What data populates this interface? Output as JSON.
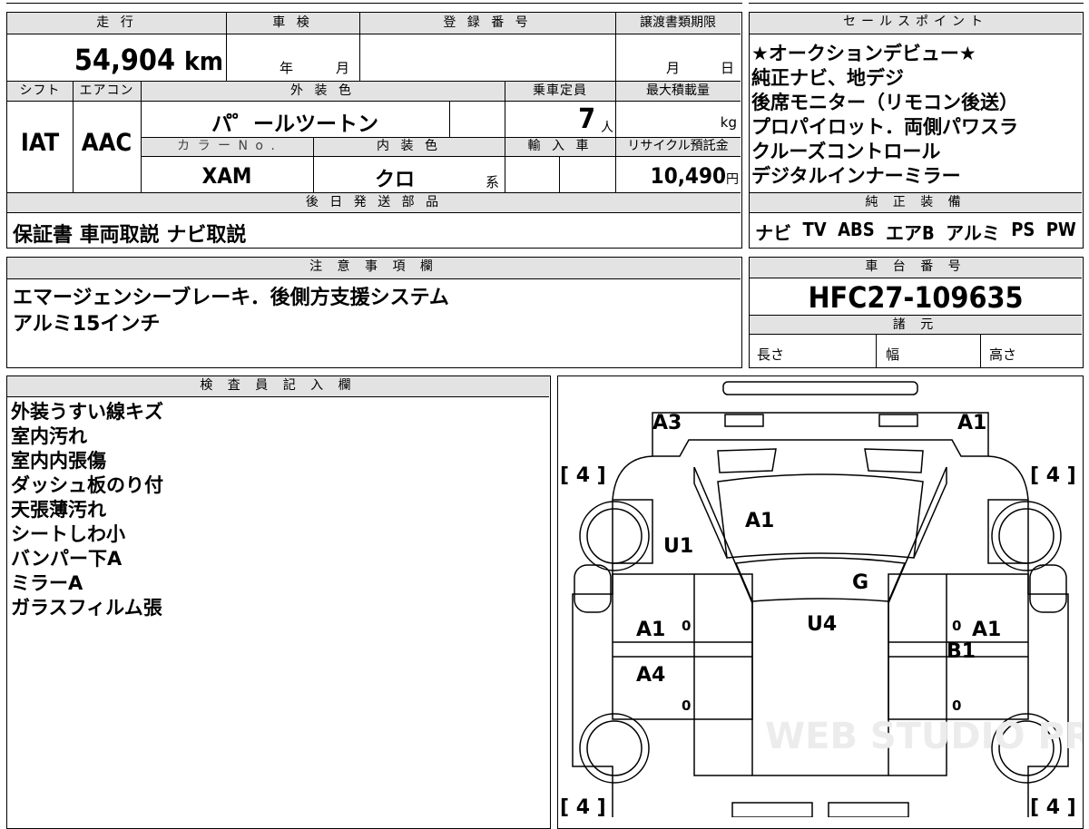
{
  "vehicle": {
    "mileage_label": "走 行",
    "mileage_value": "54,904",
    "mileage_unit": "km",
    "inspection_label": "車 検",
    "inspection_year": "年",
    "inspection_month": "月",
    "reg_label": "登 録 番 号",
    "transfer_label": "譲渡書類期限",
    "transfer_month": "月",
    "transfer_day": "日",
    "shift_label": "シフト",
    "shift_value": "IAT",
    "ac_label": "エアコン",
    "ac_value": "AAC",
    "exterior_label": "外 装 色",
    "exterior_value": "パ゜ールツートン",
    "capacity_label": "乗車定員",
    "capacity_value": "7",
    "capacity_unit": "人",
    "load_label": "最大積載量",
    "load_unit": "kg",
    "color_no_label": "カ ラ ー N o .",
    "color_no_value": "XAM",
    "interior_label": "内 装 色",
    "interior_value": "クロ",
    "interior_suffix": "系",
    "import_label": "輸 入 車",
    "recycle_label": "リサイクル預託金",
    "recycle_value": "10,490",
    "recycle_unit": "円",
    "later_label": "後 日 発 送 部 品",
    "later_value": "保証書 車両取説 ナビ取説"
  },
  "sales": {
    "label": "セールスポイント",
    "items": [
      "★オークションデビュー★",
      "純正ナビ、地デジ",
      "後席モニター（リモコン後送）",
      "プロパイロット．両側パワスラ",
      "クルーズコントロール",
      "デジタルインナーミラー"
    ]
  },
  "equipment": {
    "label": "純 正 装 備",
    "items": [
      "ナビ",
      "TV",
      "ABS",
      "エアB",
      "アルミ",
      "PS",
      "PW"
    ]
  },
  "notes": {
    "label": "注 意 事 項 欄",
    "lines": [
      "エマージェンシーブレーキ．後側方支援システム",
      "アルミ15インチ"
    ]
  },
  "chassis": {
    "label": "車 台 番 号",
    "value": "HFC27-109635",
    "spec_label": "諸 元",
    "length_label": "長さ",
    "width_label": "幅",
    "height_label": "高さ"
  },
  "inspector": {
    "label": "検 査 員 記 入 欄",
    "items": [
      "外装うすい線キズ",
      "室内汚れ",
      "室内内張傷",
      "ダッシュ板のり付",
      "天張薄汚れ",
      "シートしわ小",
      "バンパー下A",
      "ミラーA",
      "ガラスフィルム張"
    ]
  },
  "diagram": {
    "marks": [
      "A3",
      "A1",
      "A1",
      "U1",
      "G",
      "A1",
      "U4",
      "A1",
      "B1",
      "A4"
    ],
    "zeros": [
      "0",
      "0",
      "0",
      "0"
    ],
    "tires": [
      "[ 4 ]",
      "[ 4 ]",
      "[ 4 ]",
      "[ 4 ]"
    ],
    "watermark": "WEB STUDIO PRO"
  }
}
